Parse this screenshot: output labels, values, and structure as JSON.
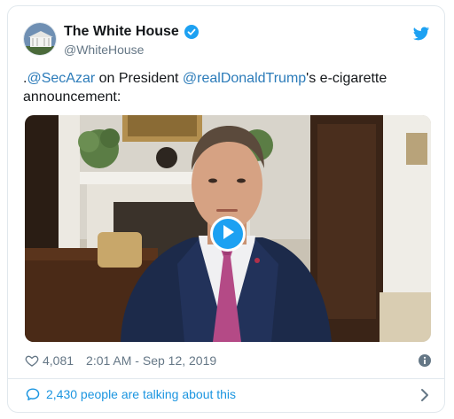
{
  "account": {
    "name": "The White House",
    "handle": "@WhiteHouse"
  },
  "tweet": {
    "prefix": ".",
    "mention1": "@SecAzar",
    "middle": " on President ",
    "mention2": "@realDonaldTrump",
    "suffix": "'s e-cigarette announcement:"
  },
  "stats": {
    "likes": "4,081",
    "timestamp": "2:01 AM - Sep 12, 2019"
  },
  "conversation": {
    "label": "2,430 people are talking about this"
  },
  "icons": {
    "verified": "verified-badge-icon",
    "bird": "twitter-bird-icon",
    "heart": "heart-icon",
    "info": "info-icon",
    "bubble": "speech-bubble-icon",
    "chevron": "chevron-right-icon",
    "play": "play-icon"
  },
  "colors": {
    "brand": "#1da1f2",
    "link": "#2b7bb9",
    "muted": "#657786"
  }
}
